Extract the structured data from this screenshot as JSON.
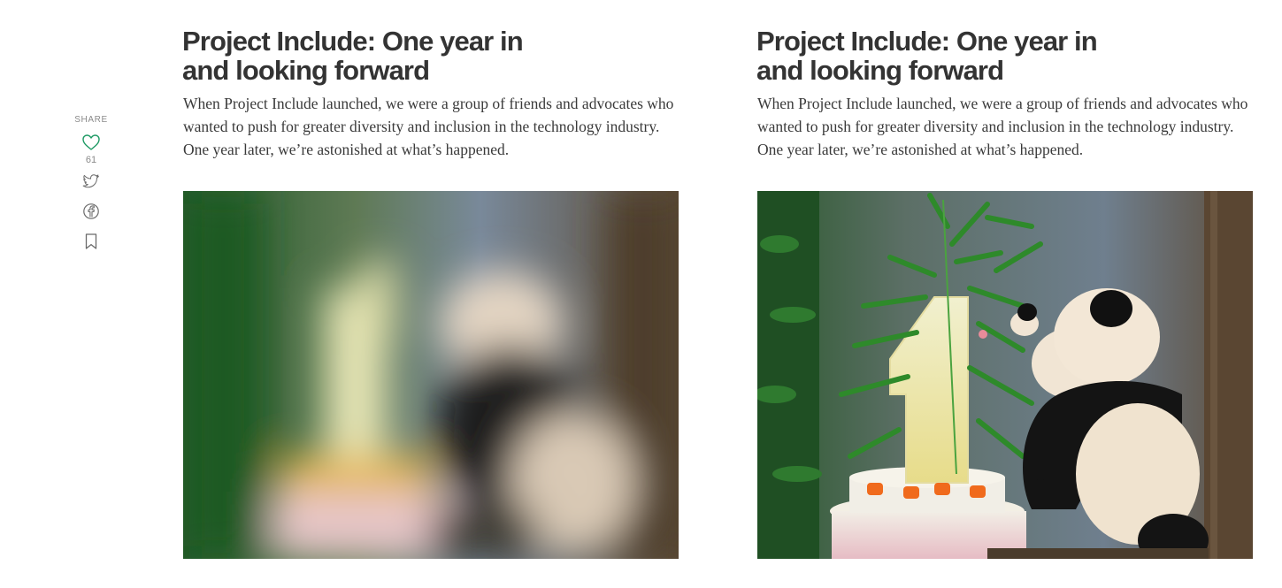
{
  "share": {
    "label": "SHARE",
    "like_count": "61",
    "accent_color": "#1c9963",
    "icons": [
      "heart-icon",
      "twitter-icon",
      "facebook-icon",
      "bookmark-icon"
    ]
  },
  "articles": [
    {
      "title": "Project Include: One year in and looking forward",
      "summary": "When Project Include launched, we were a group of friends and advocates who wanted to push for greater diversity and inclusion in the technology industry. One year later, we’re astonished at what’s happened.",
      "image": "blurred-panda-cake-photo"
    },
    {
      "title": "Project Include: One year in and looking forward",
      "summary": "When Project Include launched, we were a group of friends and advocates who wanted to push for greater diversity and inclusion in the technology industry. One year later, we’re astonished at what’s happened.",
      "image": "panda-cake-photo"
    }
  ]
}
